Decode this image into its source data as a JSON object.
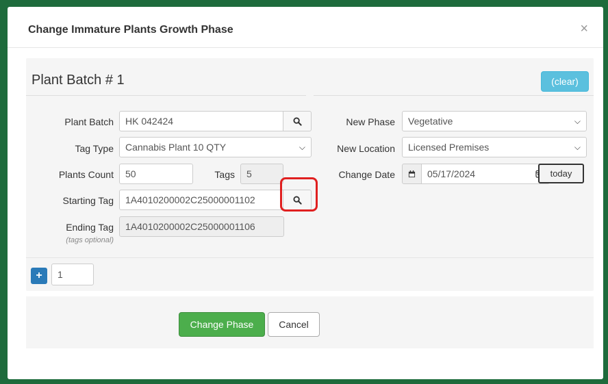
{
  "modal": {
    "title": "Change Immature Plants Growth Phase",
    "close_icon": "close-icon"
  },
  "batch": {
    "title": "Plant Batch # 1",
    "clear_label": "(clear)",
    "plant_batch_label": "Plant Batch",
    "plant_batch_value": "HK 042424",
    "tag_type_label": "Tag Type",
    "tag_type_value": "Cannabis Plant 10 QTY",
    "plants_count_label": "Plants Count",
    "plants_count_value": "50",
    "tags_label": "Tags",
    "tags_value": "5",
    "starting_tag_label": "Starting Tag",
    "starting_tag_value": "1A4010200002C25000001102",
    "ending_tag_label": "Ending Tag",
    "ending_tag_value": "1A4010200002C25000001106",
    "tags_optional_note": "(tags optional)",
    "new_phase_label": "New Phase",
    "new_phase_value": "Vegetative",
    "new_location_label": "New Location",
    "new_location_value": "Licensed Premises",
    "change_date_label": "Change Date",
    "change_date_value": "05/17/2024",
    "today_label": "today"
  },
  "add_row": {
    "count_value": "1"
  },
  "footer": {
    "change_phase_label": "Change Phase",
    "cancel_label": "Cancel"
  },
  "colors": {
    "background": "#1e6b3c",
    "clear_button": "#5bc0de",
    "primary_button": "#4cae4c",
    "add_button": "#2a7ab8",
    "highlight": "#e02020"
  }
}
